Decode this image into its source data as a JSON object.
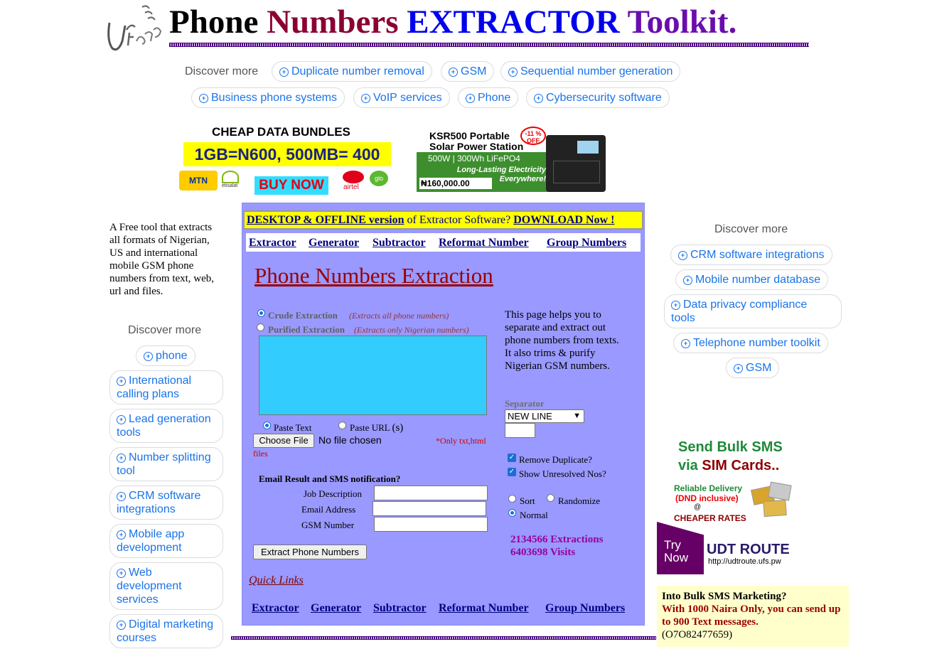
{
  "header": {
    "title_phone": "Phone",
    "title_numbers": "Numbers",
    "title_extractor": "EXTRACTOR",
    "title_toolkit": "Toolkit.",
    "colors": {
      "phone": "#000000",
      "numbers": "#8b0033",
      "extractor": "#0000ee",
      "toolkit": "#6a0dad"
    }
  },
  "discover_top": {
    "label": "Discover more",
    "chips": [
      "Duplicate number removal",
      "GSM",
      "Sequential number generation",
      "Business phone systems",
      "VoIP services",
      "Phone",
      "Cybersecurity software"
    ]
  },
  "ad_data": {
    "headline": "CHEAP DATA BUNDLES",
    "price": "1GB=N600, 500MB= 400",
    "mtn": "MTN",
    "etisalat": "etisalat",
    "buy": "BUY NOW",
    "airtel": "airtel",
    "glo": "glo"
  },
  "ad_solar": {
    "title1": "KSR500 Portable",
    "title2": "Solar Power Station",
    "discount": "-11 %",
    "off": "OFF",
    "spec": "500W | 300Wh LiFePO4",
    "tagline1": "Long-Lasting Electricity",
    "tagline2": "Everywhere!",
    "price": "₦160,000.00"
  },
  "left": {
    "description": "A Free tool that extracts all formats of Nigerian, US and international mobile GSM phone numbers from text, web, url and files.",
    "discover_label": "Discover more",
    "chips": [
      "phone",
      "International calling plans",
      "Lead generation tools",
      "Number splitting tool",
      "CRM software integrations",
      "Mobile app development",
      "Web development services",
      "Digital marketing courses"
    ]
  },
  "right": {
    "discover_label": "Discover more",
    "chips": [
      "CRM software integrations",
      "Mobile number database",
      "Data privacy compliance tools",
      "Telephone number toolkit",
      "GSM"
    ]
  },
  "download_banner": {
    "part1": "DESKTOP & OFFLINE version",
    "part2": " of Extractor Software? ",
    "part3": "DOWNLOAD Now !"
  },
  "nav": [
    "Extractor",
    "Generator",
    "Subtractor",
    "Reformat Number",
    "Group Numbers"
  ],
  "main": {
    "heading": "Phone Numbers Extraction",
    "crude_label": "Crude Extraction",
    "crude_note": "(Extracts all phone numbers)",
    "purified_label": "Purified Extraction",
    "purified_note": "(Extracts only Nigerian numbers)",
    "paste_text": "Paste Text",
    "paste_url": "Paste URL",
    "paste_url_suffix": "(s)",
    "choose_file": "Choose File",
    "no_file": "No file chosen",
    "file_note": "*Only txt,html",
    "file_note2": "files",
    "email_heading": "Email Result and SMS notification?",
    "job_label": "Job Description",
    "email_label": "Email Address",
    "gsm_label": "GSM Number",
    "extract_button": "Extract Phone Numbers",
    "help_text": "This page helps you to separate and extract out phone numbers from texts. It also trims & purify Nigerian GSM numbers.",
    "separator_label": "Separator",
    "separator_value": "NEW LINE",
    "remove_duplicate": "Remove Duplicate?",
    "show_unresolved": "Show Unresolved Nos?",
    "sort": "Sort",
    "randomize": "Randomize",
    "normal": "Normal",
    "extractions": "2134566 Extractions",
    "visits": "6403698 Visits",
    "quick_links": "Quick Links"
  },
  "sms_ad": {
    "line1": "Send Bulk SMS",
    "line2_a": "via ",
    "line2_b": "SIM Cards..",
    "reliable": "Reliable Delivery",
    "dnd": "(DND inclusive)",
    "at": "@",
    "cheaper": "CHEAPER RATES",
    "try": "Try",
    "now": "Now",
    "brand": "UDT ROUTE",
    "url": "http://udtroute.ufs.pw"
  },
  "sms_box": {
    "title": "Into Bulk SMS Marketing?",
    "body": "With 1000 Naira Only, you can send up to 900 Text messages.",
    "phone": "(O7O82477659)"
  }
}
